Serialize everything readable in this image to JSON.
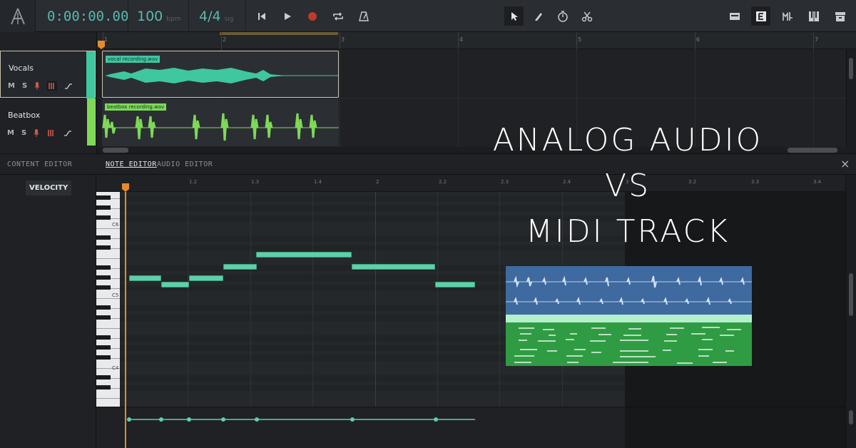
{
  "transport": {
    "time": "0:00:00.00",
    "bpm_value": "100",
    "bpm_unit": "bpm",
    "sig_value": "4/4",
    "sig_unit": "sig"
  },
  "arrange": {
    "ruler_ticks": [
      "1",
      "2",
      "3",
      "4",
      "5",
      "6",
      "7"
    ],
    "tracks": [
      {
        "name": "Vocals",
        "mute": "M",
        "solo": "S",
        "color": "#3ec7a0",
        "clip_label": "vocal recording.wav"
      },
      {
        "name": "Beatbox",
        "mute": "M",
        "solo": "S",
        "color": "#7ed957",
        "clip_label": "beatbox recording.wav"
      }
    ]
  },
  "editor": {
    "panel_title": "CONTENT EDITOR",
    "tab_note": "NOTE EDITOR",
    "tab_audio": "AUDIO EDITOR",
    "close": "×",
    "velocity_button": "VELOCITY",
    "ruler_ticks": [
      "1.2",
      "1.3",
      "1.4",
      "2",
      "2.2",
      "2.3",
      "2.4",
      "3",
      "3.2",
      "3.3",
      "3.4"
    ],
    "octave_labels": [
      "C6",
      "C5",
      "C4"
    ]
  },
  "overlay": {
    "line1": "ANALOG AUDIO",
    "line2": "VS",
    "line3": "MIDI TRACK"
  },
  "colors": {
    "accent": "#5bb7b0",
    "note": "#5fcfa9",
    "playhead": "#e8892a",
    "vocals": "#3ec7a0",
    "beatbox": "#7ed957",
    "record": "#c0392b"
  },
  "icons": [
    "logo-icon",
    "skip-back-icon",
    "play-icon",
    "record-icon",
    "loop-icon",
    "metronome-icon",
    "pointer-icon",
    "pencil-icon",
    "timer-icon",
    "scissors-icon",
    "mixer-icon",
    "editor-icon",
    "instrument-icon",
    "piano-icon",
    "archive-icon",
    "mic-icon",
    "keyboard-icon",
    "automation-icon",
    "close-icon"
  ]
}
